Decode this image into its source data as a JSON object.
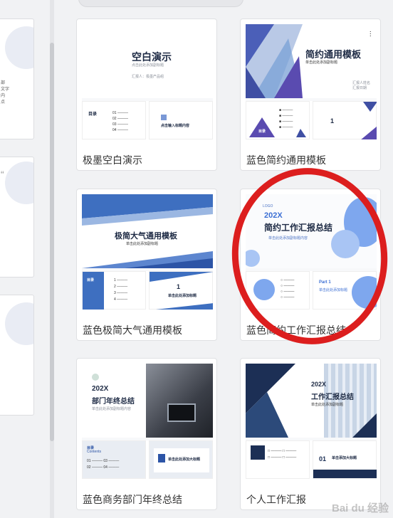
{
  "templates": [
    {
      "label": "极墨空白演示",
      "thumb_title": "空白演示",
      "thumb_sub": "点击此处添加副标题",
      "thumb_info": "汇报人：极墨产品组",
      "toc_label": "目录",
      "section_text": "点击输入标题内容"
    },
    {
      "label": "蓝色简约通用模板",
      "thumb_title": "简约通用模板",
      "thumb_sub": "单击此处添加副标题",
      "toc_label": "目录",
      "section_num": "1"
    },
    {
      "label": "蓝色极简大气通用模板",
      "thumb_title": "极简大气通用模板",
      "thumb_sub": "单击此处添加副标题",
      "toc_label": "目录",
      "section_num": "1",
      "section_text": "单击此处添加标题"
    },
    {
      "label": "蓝色简约工作汇报总结",
      "thumb_logo": "LOGO",
      "thumb_year": "202X",
      "thumb_title": "简约工作汇报总结",
      "thumb_sub": "单击此处添加副标题内容",
      "part_label": "Part 1",
      "part_text": "单击此处添加标题"
    },
    {
      "label": "蓝色商务部门年终总结",
      "thumb_year": "202X",
      "thumb_title": "部门年终总结",
      "thumb_sub": "单击此处添加副标题内容",
      "toc_label": "目录",
      "toc_sub": "Contents",
      "section_text": "单击此处添加大标题"
    },
    {
      "label": "个人工作汇报",
      "thumb_year": "202X",
      "thumb_title": "工作汇报总结",
      "thumb_sub": "单击此处添加副标题",
      "section_num": "01",
      "section_text": "单击添加大标题"
    }
  ],
  "watermark": "Bai du 经验",
  "colors": {
    "accent_blue": "#4a72c4",
    "highlight_red": "#dc1e1e",
    "navy": "#1c2f55"
  }
}
